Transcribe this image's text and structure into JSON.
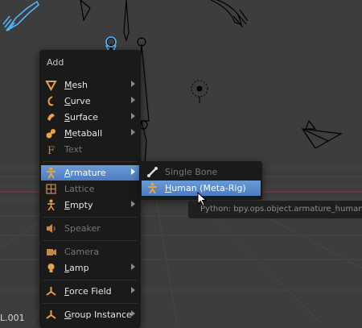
{
  "add_menu": {
    "title": "Add",
    "items": [
      {
        "label": "Mesh",
        "hotkey": "M",
        "rest": "esh",
        "icon": "mesh-icon"
      },
      {
        "label": "Curve",
        "hotkey": "C",
        "rest": "urve",
        "icon": "curve-icon"
      },
      {
        "label": "Surface",
        "hotkey": "S",
        "rest": "urface",
        "icon": "surface-icon"
      },
      {
        "label": "Metaball",
        "hotkey": "M",
        "rest": "etaball",
        "icon": "metaball-icon"
      },
      {
        "label": "Text",
        "icon": "text-icon",
        "disabled": true
      },
      {
        "label": "Armature",
        "hotkey": "A",
        "rest": "rmature",
        "icon": "armature-icon",
        "active": true
      },
      {
        "label": "Lattice",
        "icon": "lattice-icon",
        "disabled": true
      },
      {
        "label": "Empty",
        "hotkey": "E",
        "rest": "mpty",
        "icon": "empty-icon"
      },
      {
        "label": "Speaker",
        "icon": "speaker-icon",
        "disabled": true
      },
      {
        "label": "Camera",
        "icon": "camera-icon",
        "disabled": true
      },
      {
        "label": "Lamp",
        "hotkey": "L",
        "rest": "amp",
        "icon": "lamp-icon"
      },
      {
        "label": "Force Field",
        "hotkey": "F",
        "rest": "orce Field",
        "icon": "force-field-icon"
      },
      {
        "label": "Group Instance",
        "hotkey": "G",
        "rest": "roup Instance",
        "icon": "group-instance-icon"
      }
    ]
  },
  "armature_submenu": {
    "items": [
      {
        "label": "Single Bone",
        "icon": "bone-icon",
        "disabled": true
      },
      {
        "label": "Human (Meta-Rig)",
        "hotkey": "H",
        "rest": "uman (Meta-Rig)",
        "icon": "armature-icon",
        "active": true
      }
    ]
  },
  "tooltip": {
    "text": "Python: bpy.ops.object.armature_human"
  },
  "viewport": {
    "object_label": "L.001"
  },
  "colors": {
    "background": "#3d3d3d",
    "menu_bg": "#1a1a1a",
    "highlight": "#5a8ccd",
    "icon_orange": "#e8a24a",
    "selected_blue": "#4fb7ff"
  }
}
